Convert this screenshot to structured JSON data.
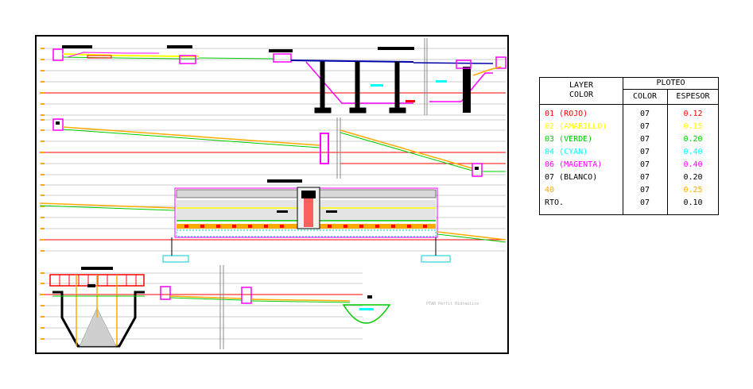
{
  "drawing": {
    "caption": "PTAR Perfil Hidraulico"
  },
  "legend": {
    "header_layer": "LAYER",
    "header_color": "COLOR",
    "header_ploteo": "PLOTEO",
    "col_color": "COLOR",
    "col_espesor": "ESPESOR",
    "rows": [
      {
        "layer": "01  (ROJO)",
        "color": "07",
        "espesor": "0.12",
        "hex": "#ff0000"
      },
      {
        "layer": "02  (AMARILLO)",
        "color": "07",
        "espesor": "0.15",
        "hex": "#ffff00"
      },
      {
        "layer": "03  (VERDE)",
        "color": "07",
        "espesor": "0.20",
        "hex": "#00cc00"
      },
      {
        "layer": "04  (CYAN)",
        "color": "07",
        "espesor": "0.40",
        "hex": "#00ffff"
      },
      {
        "layer": "06  (MAGENTA)",
        "color": "07",
        "espesor": "0.40",
        "hex": "#ff00ff"
      },
      {
        "layer": "07  (BLANCO)",
        "color": "07",
        "espesor": "0.20",
        "hex": "#000000"
      },
      {
        "layer": "40",
        "color": "07",
        "espesor": "0.25",
        "hex": "#ffaa00"
      },
      {
        "layer": "RTO.",
        "color": "07",
        "espesor": "0.10",
        "hex": "#000000"
      }
    ]
  },
  "colors": {
    "red": "#ff0000",
    "yellow": "#ffff00",
    "green": "#00cc00",
    "cyan": "#00ffff",
    "magenta": "#ff00ff",
    "orange": "#ffaa00",
    "black": "#000000",
    "gray": "#a0a0a0"
  }
}
